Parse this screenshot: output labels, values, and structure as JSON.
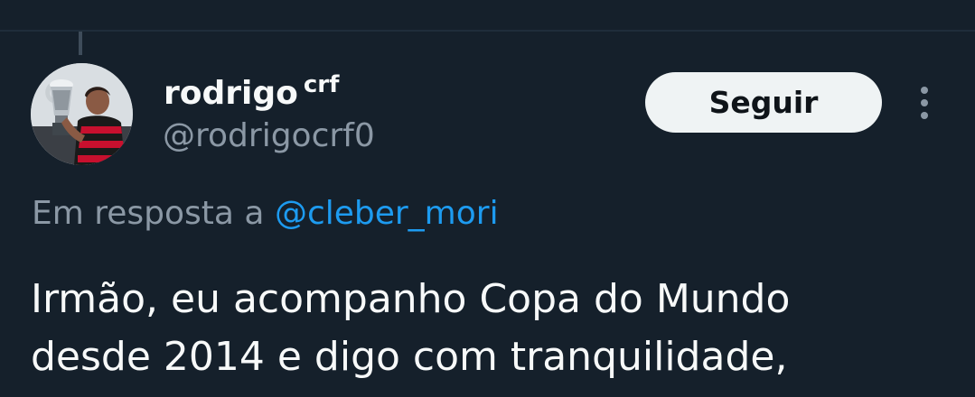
{
  "author": {
    "display_name": "rodrigo",
    "display_name_suffix": "crf",
    "handle": "@rodrigocrf0",
    "avatar_icon": "profile-photo-trophy"
  },
  "actions": {
    "follow_label": "Seguir",
    "more_icon": "more-vertical-icon"
  },
  "reply_context": {
    "prefix": "Em resposta a",
    "mention": "@cleber_mori"
  },
  "tweet": {
    "lines": [
      "Irmão, eu acompanho Copa do Mundo",
      "desde 2014 e digo com tranquilidade,"
    ]
  },
  "colors": {
    "background": "#15202b",
    "text_primary": "#f7f9f9",
    "text_secondary": "#8b98a5",
    "link": "#1d9bf0",
    "button_bg": "#eff3f4"
  }
}
